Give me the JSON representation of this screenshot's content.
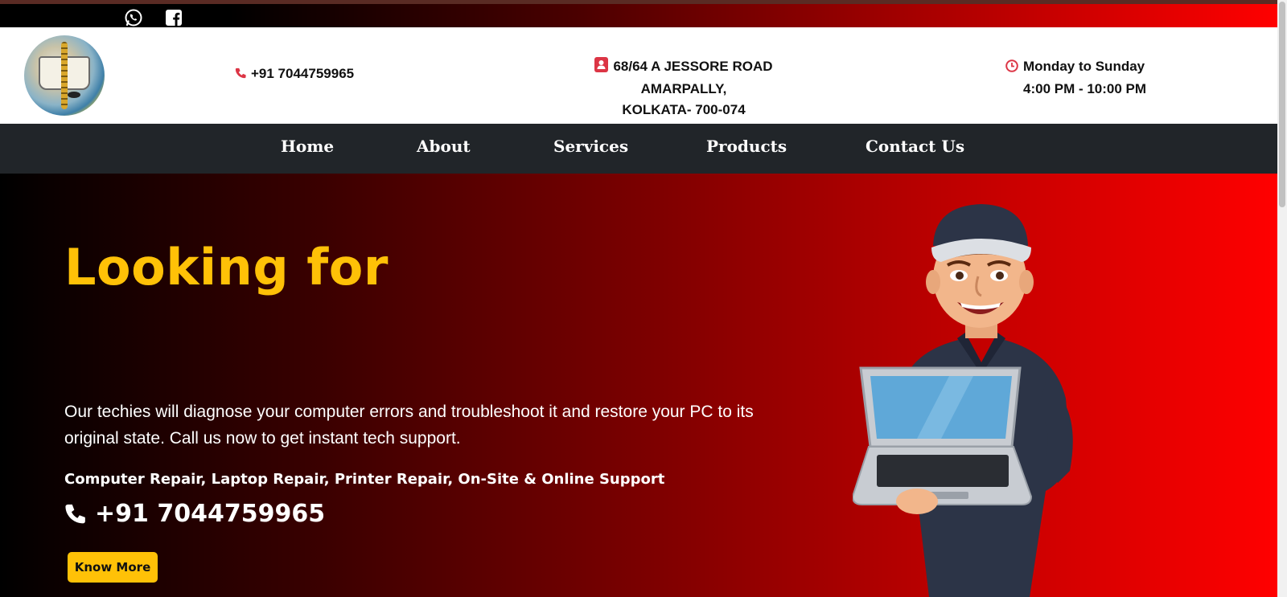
{
  "social": {
    "whatsapp_icon": "whatsapp-icon",
    "facebook_icon": "facebook-icon"
  },
  "header": {
    "phone": "+91 7044759965",
    "address_line1": "68/64 A JESSORE ROAD AMARPALLY,",
    "address_line2": "KOLKATA- 700-074",
    "hours_line1": "Monday to Sunday",
    "hours_line2": "4:00 PM - 10:00 PM"
  },
  "nav": {
    "items": [
      {
        "label": "Home"
      },
      {
        "label": "About"
      },
      {
        "label": "Services"
      },
      {
        "label": "Products"
      },
      {
        "label": "Contact Us"
      }
    ]
  },
  "hero": {
    "title": "Looking for",
    "description": "Our techies will diagnose your computer errors and troubleshoot it and restore your PC to its original state. Call us now to get instant tech support.",
    "services": "Computer Repair, Laptop Repair, Printer Repair, On-Site & Online Support",
    "phone": "+91 7044759965",
    "button_label": "Know More"
  },
  "colors": {
    "accent": "#ffc107",
    "nav_bg": "#212529",
    "hero_red": "#ff0000",
    "icon_red": "#dc3545"
  }
}
